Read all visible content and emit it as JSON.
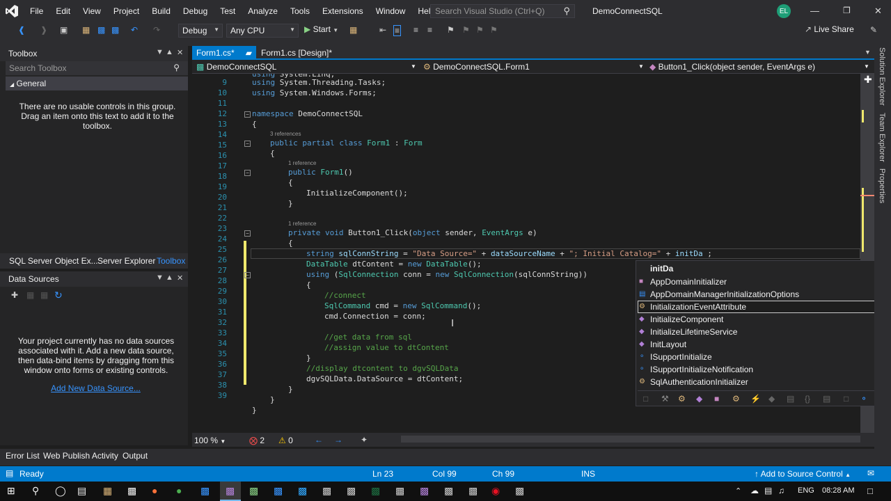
{
  "menu": [
    "File",
    "Edit",
    "View",
    "Project",
    "Build",
    "Debug",
    "Test",
    "Analyze",
    "Tools",
    "Extensions",
    "Window",
    "Help"
  ],
  "search": {
    "placeholder": "Search Visual Studio (Ctrl+Q)"
  },
  "solution_title": "DemoConnectSQL",
  "avatar": "EL",
  "toolbar": {
    "config": "Debug",
    "platform": "Any CPU",
    "start": "Start",
    "live_share": "Live Share"
  },
  "toolbox": {
    "title": "Toolbox",
    "search_placeholder": "Search Toolbox",
    "group": "General",
    "empty_text": "There are no usable controls in this group. Drag an item onto this text to add it to the toolbox.",
    "tabs": [
      "SQL Server Object Ex...",
      "Server Explorer",
      "Toolbox"
    ]
  },
  "data_sources": {
    "title": "Data Sources",
    "empty_text": "Your project currently has no data sources associated with it. Add a new data source, then data-bind items by dragging from this window onto forms or existing controls.",
    "add_link": "Add New Data Source..."
  },
  "editor_tabs": [
    {
      "label": "Form1.cs*",
      "active": true
    },
    {
      "label": "Form1.cs [Design]*",
      "active": false
    }
  ],
  "nav": {
    "project": "DemoConnectSQL",
    "class": "DemoConnectSQL.Form1",
    "member": "Button1_Click(object sender, EventArgs e)"
  },
  "refs": {
    "r3": "3 references",
    "r1a": "1 reference",
    "r1b": "1 reference"
  },
  "line_numbers": [
    "9",
    "10",
    "11",
    "12",
    "13",
    "14",
    "15",
    "16",
    "17",
    "18",
    "19",
    "20",
    "21",
    "22",
    "23",
    "24",
    "25",
    "26",
    "27",
    "28",
    "29",
    "30",
    "31",
    "32",
    "33",
    "34",
    "35",
    "36",
    "37",
    "38",
    "39"
  ],
  "intellisense": {
    "typed": "initDa",
    "items": [
      "AppDomainInitializer",
      "AppDomainManagerInitializationOptions",
      "InitializationEventAttribute",
      "InitializeComponent",
      "InitializeLifetimeService",
      "InitLayout",
      "ISupportInitialize",
      "ISupportInitializeNotification",
      "SqlAuthenticationInitializer"
    ],
    "selected_index": 2
  },
  "zoom": "100 %",
  "errors": "2",
  "warnings": "0",
  "bottom_tabs": [
    "Error List",
    "Web Publish Activity",
    "Output"
  ],
  "status": {
    "ready": "Ready",
    "ln": "Ln 23",
    "col": "Col 99",
    "ch": "Ch 99",
    "ins": "INS",
    "source_control": "Add to Source Control"
  },
  "right_strip": [
    "Solution Explorer",
    "Team Explorer",
    "Properties"
  ],
  "taskbar": {
    "lang": "ENG",
    "time": "08:28 AM"
  },
  "colors": {
    "accent": "#007acc",
    "bg": "#1e1e1e",
    "keyword": "#569cd6",
    "type": "#4ec9b0",
    "string": "#d69d85",
    "comment": "#57a64a"
  }
}
